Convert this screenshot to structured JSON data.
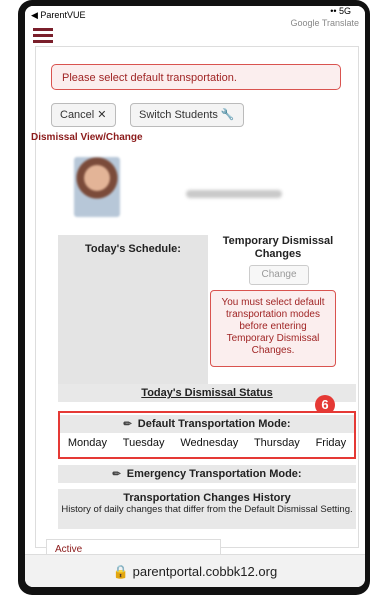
{
  "status_bar": {
    "back_app": "◀ ParentVUE",
    "google_translate": "Google Translate",
    "signal": "•• 5G"
  },
  "alert": {
    "message": "Please select default transportation."
  },
  "toolbar": {
    "cancel_label": "Cancel ✕",
    "switch_students_label": "Switch Students 🔧"
  },
  "section": {
    "title": "Dismissal View/Change"
  },
  "schedule": {
    "label": "Today's Schedule:"
  },
  "temporary": {
    "title": "Temporary Dismissal Changes",
    "change_label": "Change",
    "warning": "You must select default transportation modes before entering Temporary Dismissal Changes."
  },
  "dismissal_status": {
    "label": "Today's Dismissal Status"
  },
  "default_transport": {
    "title": "Default Transportation Mode:",
    "days": [
      "Monday",
      "Tuesday",
      "Wednesday",
      "Thursday",
      "Friday"
    ]
  },
  "annotation": {
    "badge": "6"
  },
  "emergency_transport": {
    "title": "Emergency Transportation Mode:"
  },
  "history": {
    "title": "Transportation Changes History",
    "description": "History of daily changes that differ from the Default Dismissal Setting."
  },
  "tabs": {
    "active_label": "Active"
  },
  "url": {
    "text": "🔒 parentportal.cobbk12.org"
  },
  "colors": {
    "accent": "#8b1a1a",
    "highlight": "#e53935"
  }
}
